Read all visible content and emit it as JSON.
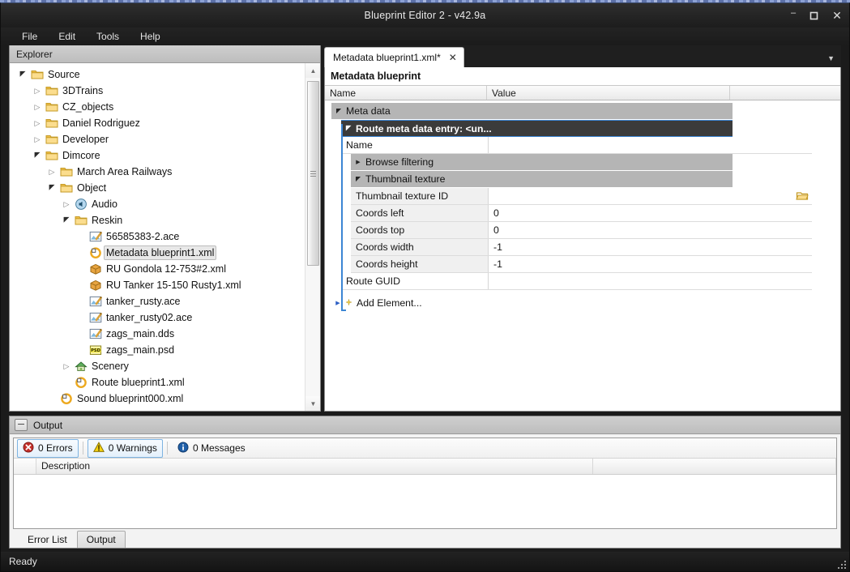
{
  "window": {
    "title": "Blueprint Editor 2 - v42.9a",
    "minimize_label": "–",
    "maximize_label": "□",
    "close_label": "✕"
  },
  "menu": {
    "items": [
      {
        "label": "File"
      },
      {
        "label": "Edit"
      },
      {
        "label": "Tools"
      },
      {
        "label": "Help"
      }
    ]
  },
  "explorer": {
    "header": "Explorer",
    "tree": [
      {
        "label": "Source",
        "depth": 0,
        "twisty": "open",
        "icon": "folder-icon"
      },
      {
        "label": "3DTrains",
        "depth": 1,
        "twisty": "closed",
        "icon": "folder-icon"
      },
      {
        "label": "CZ_objects",
        "depth": 1,
        "twisty": "closed",
        "icon": "folder-icon"
      },
      {
        "label": "Daniel Rodriguez",
        "depth": 1,
        "twisty": "closed",
        "icon": "folder-icon"
      },
      {
        "label": "Developer",
        "depth": 1,
        "twisty": "closed",
        "icon": "folder-icon"
      },
      {
        "label": "Dimcore",
        "depth": 1,
        "twisty": "open",
        "icon": "folder-icon"
      },
      {
        "label": "March Area Railways",
        "depth": 2,
        "twisty": "closed",
        "icon": "folder-icon"
      },
      {
        "label": "Object",
        "depth": 2,
        "twisty": "open",
        "icon": "folder-icon"
      },
      {
        "label": "Audio",
        "depth": 3,
        "twisty": "closed",
        "icon": "audio-icon"
      },
      {
        "label": "Reskin",
        "depth": 3,
        "twisty": "open",
        "icon": "folder-icon"
      },
      {
        "label": "56585383-2.ace",
        "depth": 4,
        "twisty": "none",
        "icon": "ace-image-icon"
      },
      {
        "label": "Metadata blueprint1.xml",
        "depth": 4,
        "twisty": "none",
        "icon": "blueprint-icon",
        "selected": true
      },
      {
        "label": "RU Gondola 12-753#2.xml",
        "depth": 4,
        "twisty": "none",
        "icon": "package-icon"
      },
      {
        "label": "RU Tanker 15-150 Rusty1.xml",
        "depth": 4,
        "twisty": "none",
        "icon": "package-icon"
      },
      {
        "label": "tanker_rusty.ace",
        "depth": 4,
        "twisty": "none",
        "icon": "ace-image-icon"
      },
      {
        "label": "tanker_rusty02.ace",
        "depth": 4,
        "twisty": "none",
        "icon": "ace-image-icon"
      },
      {
        "label": "zags_main.dds",
        "depth": 4,
        "twisty": "none",
        "icon": "ace-image-icon"
      },
      {
        "label": "zags_main.psd",
        "depth": 4,
        "twisty": "none",
        "icon": "psd-icon"
      },
      {
        "label": "Scenery",
        "depth": 3,
        "twisty": "closed",
        "icon": "scenery-icon"
      },
      {
        "label": "Route blueprint1.xml",
        "depth": 3,
        "twisty": "none",
        "icon": "blueprint-icon"
      },
      {
        "label": "Sound blueprint000.xml",
        "depth": 2,
        "twisty": "none",
        "icon": "blueprint-icon"
      }
    ]
  },
  "editor": {
    "tab": {
      "label": "Metadata blueprint1.xml*",
      "close_label": "✕"
    },
    "chevron_label": "▼",
    "blueprint_title": "Metadata blueprint",
    "grid_headers": {
      "name": "Name",
      "value": "Value"
    },
    "rows": [
      {
        "kind": "category",
        "label": "Meta data",
        "value": "",
        "expanded": true,
        "indent": 0
      },
      {
        "kind": "entry",
        "label": "Route meta data entry: <un...",
        "value": "",
        "expanded": true,
        "indent": 1
      },
      {
        "kind": "prop",
        "label": "Name",
        "value": "",
        "indent": 1,
        "shaded": false
      },
      {
        "kind": "category",
        "label": "Browse filtering",
        "value": "",
        "expanded": false,
        "indent": 2
      },
      {
        "kind": "category",
        "label": "Thumbnail texture",
        "value": "",
        "expanded": true,
        "indent": 2
      },
      {
        "kind": "prop",
        "label": "Thumbnail texture ID",
        "value": "",
        "indent": 2,
        "shaded": true,
        "browse": true
      },
      {
        "kind": "prop",
        "label": "Coords left",
        "value": "0",
        "indent": 2,
        "shaded": true
      },
      {
        "kind": "prop",
        "label": "Coords top",
        "value": "0",
        "indent": 2,
        "shaded": true
      },
      {
        "kind": "prop",
        "label": "Coords width",
        "value": "-1",
        "indent": 2,
        "shaded": true
      },
      {
        "kind": "prop",
        "label": "Coords height",
        "value": "-1",
        "indent": 2,
        "shaded": true
      },
      {
        "kind": "prop",
        "label": "Route GUID",
        "value": "",
        "indent": 1,
        "shaded": false
      }
    ],
    "add_element": {
      "label": "Add Element...",
      "triangle": "▶"
    }
  },
  "output": {
    "header": "Output",
    "collapse_label": "─",
    "errors": {
      "label": "0 Errors",
      "icon": "error-icon"
    },
    "warnings": {
      "label": "0 Warnings",
      "icon": "warning-icon"
    },
    "messages": {
      "label": "0 Messages",
      "icon": "info-icon"
    },
    "list_header": {
      "description": "Description"
    },
    "rows": [],
    "tabs": [
      {
        "label": "Error List",
        "active": false
      },
      {
        "label": "Output",
        "active": true
      }
    ]
  },
  "status": {
    "text": "Ready"
  },
  "colors": {
    "accent_blue": "#3c86d4",
    "entry_row_bg": "#3b3b3b",
    "category_bg": "#b5b5b5",
    "chrome_dark": "#1b1b1b",
    "panel_header": "#c4c4c4"
  }
}
